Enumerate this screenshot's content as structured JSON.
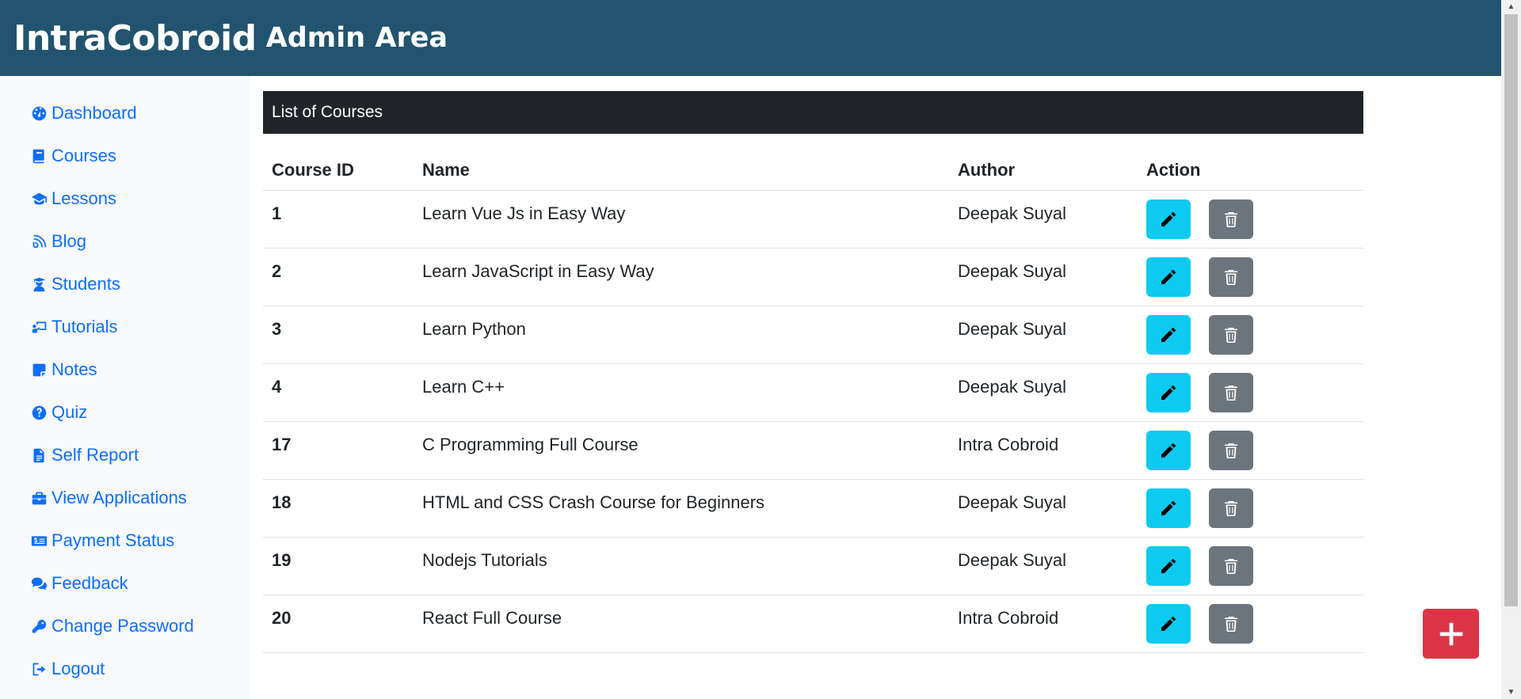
{
  "header": {
    "brand": "IntraCobroid",
    "subtitle": "Admin Area"
  },
  "sidebar": {
    "items": [
      {
        "label": "Dashboard",
        "icon": "gauge-icon"
      },
      {
        "label": "Courses",
        "icon": "book-icon"
      },
      {
        "label": "Lessons",
        "icon": "graduation-cap-icon"
      },
      {
        "label": "Blog",
        "icon": "blog-icon"
      },
      {
        "label": "Students",
        "icon": "student-icon"
      },
      {
        "label": "Tutorials",
        "icon": "chalkboard-teacher-icon"
      },
      {
        "label": "Notes",
        "icon": "sticky-note-icon"
      },
      {
        "label": "Quiz",
        "icon": "question-circle-icon"
      },
      {
        "label": "Self Report",
        "icon": "file-alt-icon"
      },
      {
        "label": "View Applications",
        "icon": "briefcase-icon"
      },
      {
        "label": "Payment Status",
        "icon": "money-check-icon"
      },
      {
        "label": "Feedback",
        "icon": "comments-icon"
      },
      {
        "label": "Change Password",
        "icon": "key-icon"
      },
      {
        "label": "Logout",
        "icon": "sign-out-icon"
      }
    ]
  },
  "main": {
    "card_title": "List of Courses",
    "columns": [
      "Course ID",
      "Name",
      "Author",
      "Action"
    ],
    "rows": [
      {
        "id": "1",
        "name": "Learn Vue Js in Easy Way",
        "author": "Deepak Suyal"
      },
      {
        "id": "2",
        "name": "Learn JavaScript in Easy Way",
        "author": "Deepak Suyal"
      },
      {
        "id": "3",
        "name": "Learn Python",
        "author": "Deepak Suyal"
      },
      {
        "id": "4",
        "name": "Learn C++",
        "author": "Deepak Suyal"
      },
      {
        "id": "17",
        "name": "C Programming Full Course",
        "author": "Intra Cobroid"
      },
      {
        "id": "18",
        "name": "HTML and CSS Crash Course for Beginners",
        "author": "Deepak Suyal"
      },
      {
        "id": "19",
        "name": "Nodejs Tutorials",
        "author": "Deepak Suyal"
      },
      {
        "id": "20",
        "name": "React Full Course",
        "author": "Intra Cobroid"
      }
    ]
  },
  "fab": {
    "icon": "plus-icon"
  },
  "colors": {
    "header_bg": "#225470",
    "link": "#0d6efd",
    "edit_button": "#0dcaf0",
    "delete_button": "#6c757d",
    "add_button": "#dc3545",
    "card_header": "#212529"
  }
}
